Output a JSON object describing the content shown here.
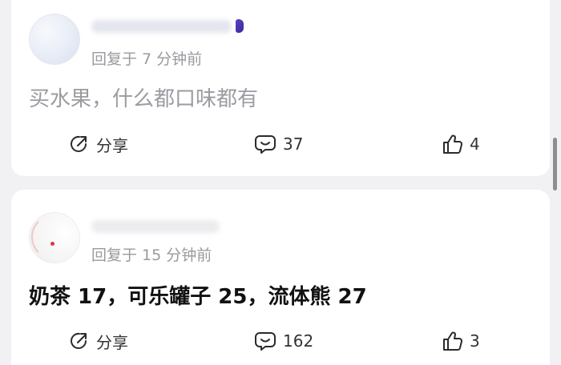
{
  "comments": [
    {
      "reply_time": "回复于 7 分钟前",
      "content": "买水果，什么都口味都有",
      "actions": {
        "share_label": "分享",
        "comment_count": "37",
        "like_count": "4"
      }
    },
    {
      "reply_time": "回复于 15 分钟前",
      "content": "奶茶 17，可乐罐子 25，流体熊 27",
      "actions": {
        "share_label": "分享",
        "comment_count": "162",
        "like_count": "3"
      }
    }
  ],
  "icons": {
    "share": "share-icon",
    "comment": "comment-icon",
    "like": "thumbs-up-icon"
  },
  "colors": {
    "page_background": "#f1f1f4",
    "card_background": "#ffffff",
    "muted_text": "#9a9a9f",
    "body_text": "#111111"
  }
}
